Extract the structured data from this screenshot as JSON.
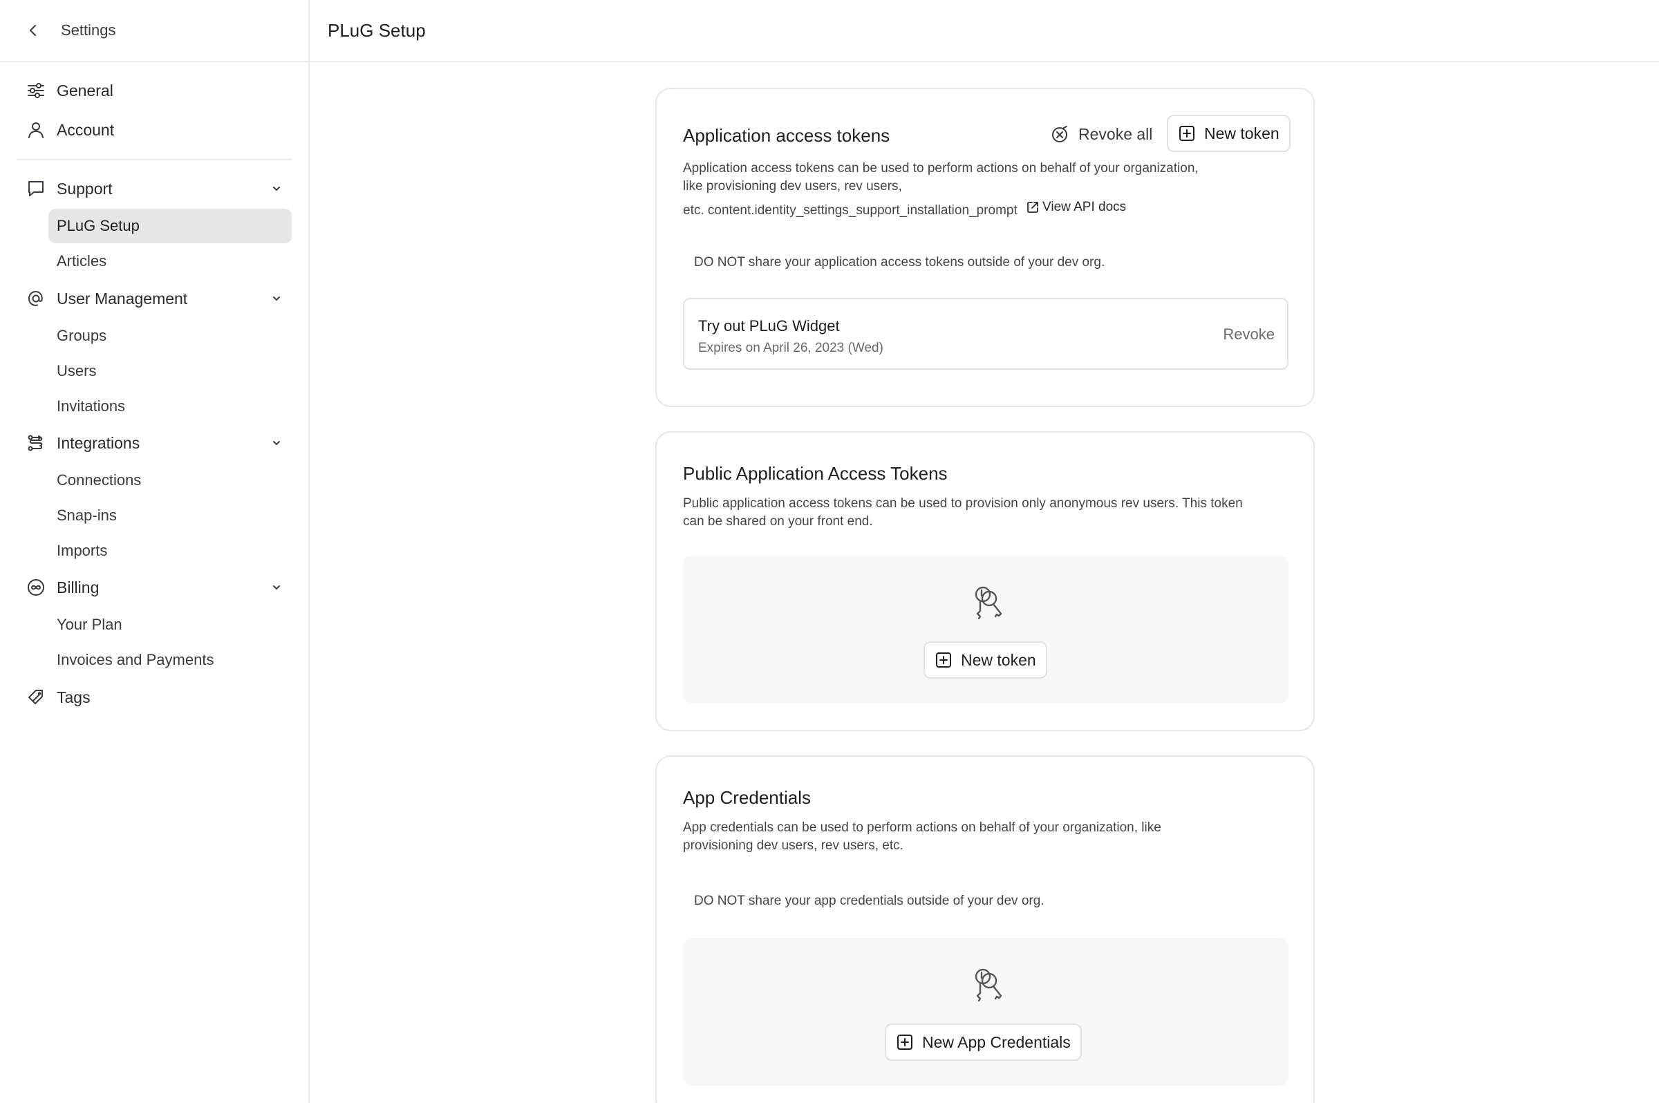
{
  "sidebar": {
    "back_label": "Settings",
    "items": {
      "general": "General",
      "account": "Account",
      "support": "Support",
      "plug_setup": "PLuG Setup",
      "articles": "Articles",
      "user_management": "User Management",
      "groups": "Groups",
      "users": "Users",
      "invitations": "Invitations",
      "integrations": "Integrations",
      "connections": "Connections",
      "snap_ins": "Snap-ins",
      "imports": "Imports",
      "billing": "Billing",
      "your_plan": "Your Plan",
      "invoices": "Invoices and Payments",
      "tags": "Tags"
    },
    "active_item": "PLuG Setup"
  },
  "header": {
    "title": "PLuG Setup"
  },
  "access_tokens": {
    "title": "Application access tokens",
    "revoke_all_label": "Revoke all",
    "new_token_label": "New token",
    "description_line1": "Application access tokens can be used to perform actions on behalf of your organization,",
    "description_line2": "like provisioning dev users, rev users,",
    "description_line3": "etc. content.identity_settings_support_installation_prompt",
    "api_docs_label": "View API docs",
    "warning": "DO NOT share your application access tokens outside of your dev org.",
    "tokens": [
      {
        "name": "Try out PLuG Widget",
        "expires": "Expires on April 26, 2023 (Wed)",
        "action": "Revoke"
      }
    ]
  },
  "public_tokens": {
    "title": "Public Application Access Tokens",
    "description": "Public application access tokens can be used to provision only anonymous rev users. This token can be shared on your front end.",
    "new_token_label": "New token"
  },
  "app_credentials": {
    "title": "App Credentials",
    "description": "App credentials can be used to perform actions on behalf of your organization, like provisioning dev users, rev users, etc.",
    "warning": "DO NOT share your app credentials outside of your dev org.",
    "new_label": "New App Credentials"
  },
  "colors": {
    "active_bg": "#e6e6ea",
    "border": "#e6e6ea",
    "empty_bg": "#f7f7f9"
  }
}
